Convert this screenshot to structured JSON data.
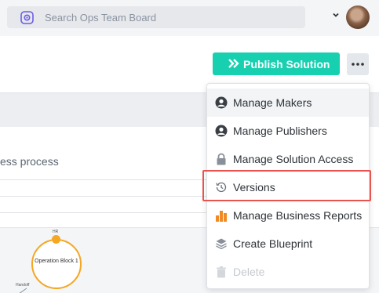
{
  "search": {
    "placeholder": "Search Ops Team Board",
    "logo_icon": "team-board-logo-icon"
  },
  "toolbar": {
    "publish_label": "Publish Solution",
    "publish_color": "#17d0b0",
    "more_icon": "ellipsis-icon"
  },
  "page": {
    "process_text_fragment": "ess process"
  },
  "diagram": {
    "block_title": "Operation Block 1",
    "top_label": "HR",
    "handoff_label": "Handoff",
    "accent": "#f5a623"
  },
  "menu": {
    "items": [
      {
        "label": "Manage Makers",
        "icon": "user-icon",
        "state": "hover"
      },
      {
        "label": "Manage Publishers",
        "icon": "user-icon"
      },
      {
        "label": "Manage Solution Access",
        "icon": "lock-icon"
      },
      {
        "label": "Versions",
        "icon": "history-clock-icon",
        "highlighted": true
      },
      {
        "label": "Manage Business Reports",
        "icon": "bar-chart-icon"
      },
      {
        "label": "Create Blueprint",
        "icon": "layers-icon"
      },
      {
        "label": "Delete",
        "icon": "trash-icon",
        "disabled": true
      }
    ],
    "highlight_color": "#e8534f"
  }
}
